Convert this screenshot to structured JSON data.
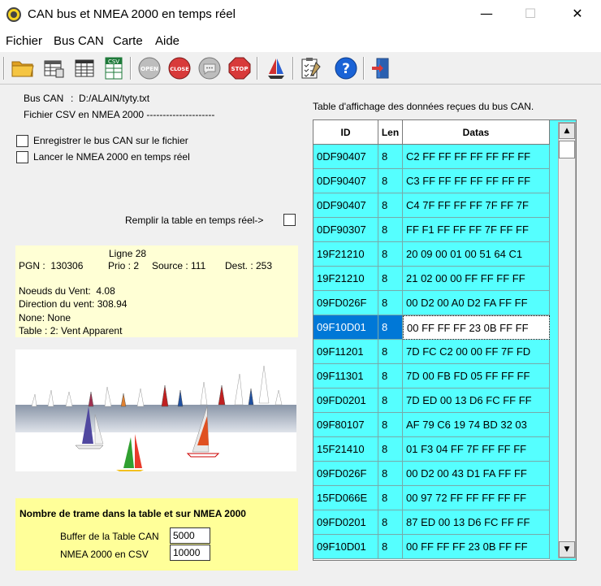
{
  "window": {
    "title": "CAN bus et NMEA 2000 en temps réel",
    "minimize": "—",
    "maximize": "☐",
    "close": "✕"
  },
  "menu": [
    "Fichier",
    "Bus CAN",
    "Carte",
    "Aide"
  ],
  "toolbar": {
    "csv_icon_text": "CSV",
    "open_text": "OPEN",
    "close_text": "CLOSE",
    "stop_text": "STOP",
    "help_text": "?",
    "icons": [
      "folder-icon",
      "table-icon",
      "spreadsheet-icon",
      "csv-icon",
      "open-icon",
      "close-circle-icon",
      "chat-icon",
      "stop-icon",
      "sailboat-icon",
      "checklist-icon",
      "help-icon",
      "exit-icon"
    ]
  },
  "file": {
    "bus_label": "Bus CAN",
    "bus_value": ":  D:/ALAIN/tyty.txt",
    "csv_label": "Fichier CSV en NMEA 2000 ---------------------"
  },
  "options": {
    "record_label": "Enregistrer le bus CAN sur le fichier",
    "launch_label": "Lancer le NMEA 2000 en temps réel",
    "fill_label": "Remplir la table en temps réel->"
  },
  "info": {
    "line": "Ligne 28",
    "pgn": "PGN :  130306",
    "prio": "Prio : 2",
    "source": "Source : 111",
    "dest": "Dest. : 253",
    "wind_knots": "Noeuds du Vent:  4.08",
    "wind_dir": "Direction du vent: 308.94",
    "none": "None: None",
    "table": "Table : 2: Vent Apparent"
  },
  "bottom": {
    "title": "Nombre de trame dans la table et sur NMEA 2000",
    "buffer_label": "Buffer de la Table CAN",
    "buffer_value": "5000",
    "nmea_label": "NMEA 2000 en CSV",
    "nmea_value": "10000"
  },
  "table": {
    "caption": "Table d'affichage des données reçues du bus CAN.",
    "columns": [
      "ID",
      "Len",
      "Datas"
    ],
    "selected_index": 7,
    "rows": [
      [
        "0DF90407",
        "8",
        "C2 FF FF FF FF FF FF FF"
      ],
      [
        "0DF90407",
        "8",
        "C3 FF FF FF FF FF FF FF"
      ],
      [
        "0DF90407",
        "8",
        "C4 7F FF FF FF 7F FF 7F"
      ],
      [
        "0DF90307",
        "8",
        "FF F1 FF FF FF 7F FF FF"
      ],
      [
        "19F21210",
        "8",
        "20 09 00 01 00 51 64 C1"
      ],
      [
        "19F21210",
        "8",
        "21 02 00 00 FF FF FF FF"
      ],
      [
        "09FD026F",
        "8",
        "00 D2 00 A0 D2 FA FF FF"
      ],
      [
        "09F10D01",
        "8",
        "00 FF FF FF 23 0B FF FF"
      ],
      [
        "09F11201",
        "8",
        "7D FC C2 00 00 FF 7F FD"
      ],
      [
        "09F11301",
        "8",
        "7D 00 FB FD 05 FF FF FF"
      ],
      [
        "09FD0201",
        "8",
        "7D ED 00 13 D6 FC FF FF"
      ],
      [
        "09F80107",
        "8",
        "AF 79 C6 19 74 BD 32 03"
      ],
      [
        "15F21410",
        "8",
        "01 F3 04 FF 7F FF FF FF"
      ],
      [
        "09FD026F",
        "8",
        "00 D2 00 43 D1 FA FF FF"
      ],
      [
        "15FD066E",
        "8",
        "00 97 72 FF FF FF FF FF"
      ],
      [
        "09FD0201",
        "8",
        "87 ED 00 13 D6 FC FF FF"
      ],
      [
        "09F10D01",
        "8",
        "00 FF FF FF 23 0B FF FF"
      ]
    ]
  },
  "colors": {
    "grid_row": "#55ffff",
    "selection": "#0078d7",
    "info_bg": "#ffffd5",
    "bottom_bg": "#ffff99"
  }
}
